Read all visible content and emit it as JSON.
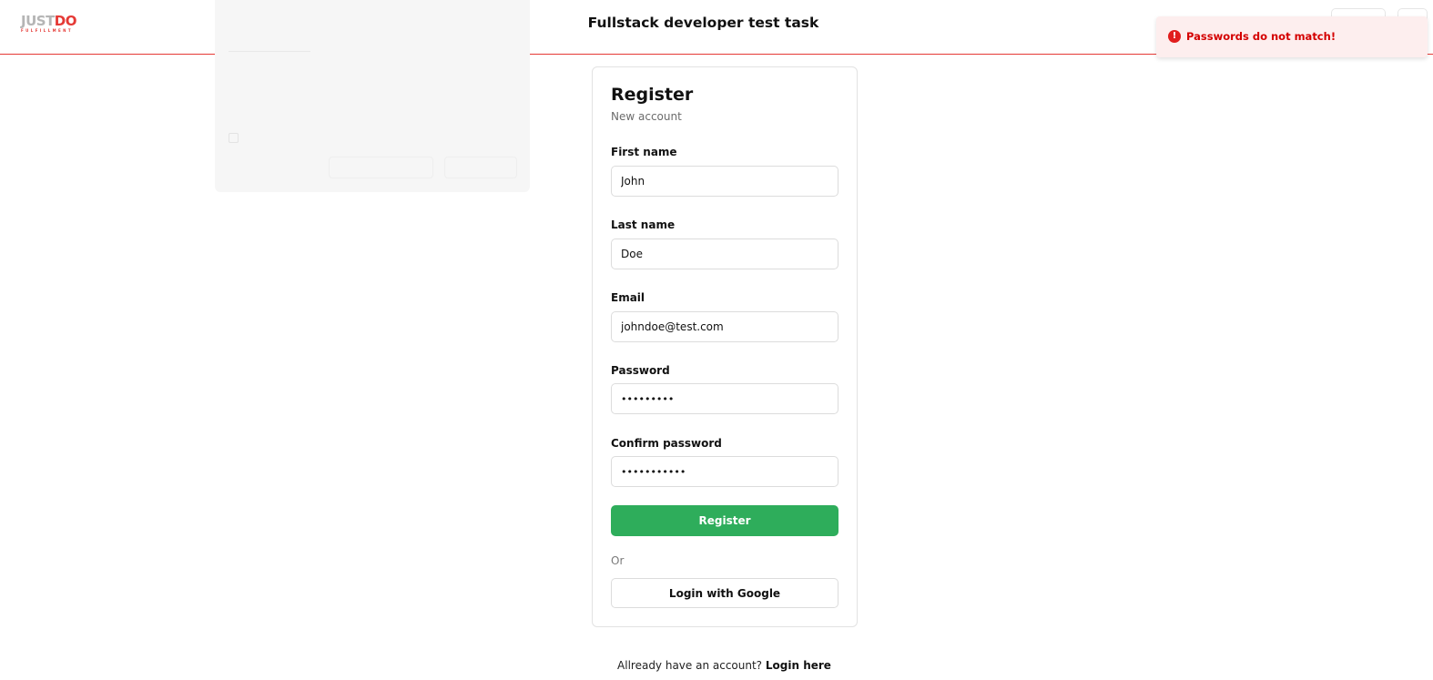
{
  "header": {
    "logo_text_just": "JUST",
    "logo_text_do": "DO",
    "logo_subtext": "FULFILLMENT",
    "title": "Fullstack developer test task"
  },
  "toast": {
    "icon": "exclamation-circle-icon",
    "message": "Passwords do not match!",
    "color": "#d40000",
    "background": "#fdeeee"
  },
  "form": {
    "title": "Register",
    "subtitle": "New account",
    "fields": [
      {
        "label": "First name",
        "value": "John",
        "type": "text"
      },
      {
        "label": "Last name",
        "value": "Doe",
        "type": "text"
      },
      {
        "label": "Email",
        "value": "johndoe@test.com",
        "type": "email"
      },
      {
        "label": "Password",
        "value": "•••••••••",
        "type": "password"
      },
      {
        "label": "Confirm password",
        "value": "•••••••••••",
        "type": "password"
      }
    ],
    "submit_label": "Register",
    "submit_color": "#2ead5b",
    "or_text": "Or",
    "google_label": "Login with Google"
  },
  "footer": {
    "prompt": "Allready have an account?",
    "login_link": "Login here"
  },
  "colors": {
    "accent_red": "#e53935",
    "accent_green": "#2ead5b"
  }
}
